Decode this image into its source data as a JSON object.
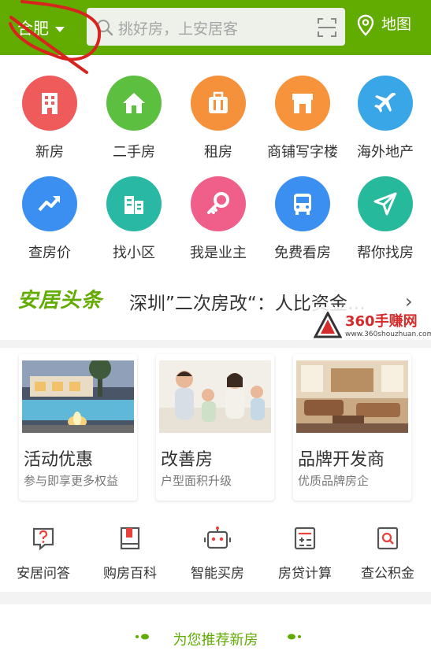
{
  "header": {
    "city": "合肥",
    "search_placeholder": "挑好房，上安居客",
    "map_label": "地图",
    "accent_color": "#62ab00"
  },
  "categories": [
    {
      "label": "新房",
      "icon": "building-icon",
      "color": "#ef5a5a"
    },
    {
      "label": "二手房",
      "icon": "house-icon",
      "color": "#5cbf3f"
    },
    {
      "label": "租房",
      "icon": "suitcase-icon",
      "color": "#f5903b"
    },
    {
      "label": "商铺写字楼",
      "icon": "storefront-icon",
      "color": "#f7943b"
    },
    {
      "label": "海外地产",
      "icon": "airplane-icon",
      "color": "#39a6e8"
    },
    {
      "label": "查房价",
      "icon": "trend-up-icon",
      "color": "#3b8ff0"
    },
    {
      "label": "找小区",
      "icon": "apartment-icon",
      "color": "#29b8a4"
    },
    {
      "label": "我是业主",
      "icon": "key-icon",
      "color": "#ef5f89"
    },
    {
      "label": "免费看房",
      "icon": "bus-icon",
      "color": "#3b8ff0"
    },
    {
      "label": "帮你找房",
      "icon": "navigation-arrow-icon",
      "color": "#27b99b"
    }
  ],
  "news": {
    "brand": "安居头条",
    "headline": "深圳”二次房改“：人比资金…"
  },
  "watermark": {
    "title": "360手赚网",
    "url": "www.360shouzhuan.com"
  },
  "promo_cards": [
    {
      "title": "活动优惠",
      "subtitle": "参与即享更多权益"
    },
    {
      "title": "改善房",
      "subtitle": "户型面积升级"
    },
    {
      "title": "品牌开发商",
      "subtitle": "优质品牌房企"
    }
  ],
  "tools": [
    {
      "label": "安居问答",
      "icon": "question-icon"
    },
    {
      "label": "购房百科",
      "icon": "book-icon"
    },
    {
      "label": "智能买房",
      "icon": "robot-icon"
    },
    {
      "label": "房贷计算",
      "icon": "calculator-icon"
    },
    {
      "label": "查公积金",
      "icon": "magnifier-doc-icon"
    }
  ],
  "recommend": {
    "label": "为您推荐新房"
  }
}
